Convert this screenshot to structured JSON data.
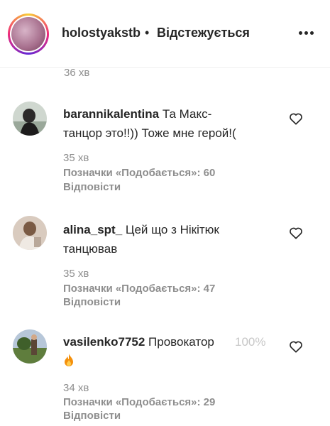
{
  "header": {
    "username": "holostyakstb",
    "separator": "•",
    "follow_status": "Відстежується"
  },
  "previous_comment": {
    "time": "36 хв"
  },
  "comments": [
    {
      "username": "barannikalentina",
      "text_line1": "Та Макс-",
      "text_line2": "танцор это!!)) Тоже мне герой!(",
      "time": "35 хв",
      "likes": "Позначки «Подобається»: 60",
      "reply": "Відповісти"
    },
    {
      "username": "alina_spt_",
      "text_line1": "Цей що з Нікітюк",
      "text_line2": "танцював",
      "time": "35 хв",
      "likes": "Позначки «Подобається»: 47",
      "reply": "Відповісти"
    },
    {
      "username": "vasilenko7752",
      "text_line1": "Провокатор",
      "overlay_text": "100%",
      "emoji": "fire-icon",
      "time": "34 хв",
      "likes": "Позначки «Подобається»: 29",
      "reply": "Відповісти"
    }
  ],
  "colors": {
    "text": "#262626",
    "muted": "#8e8e8e",
    "divider": "#efefef",
    "fire": "#f4900c"
  }
}
